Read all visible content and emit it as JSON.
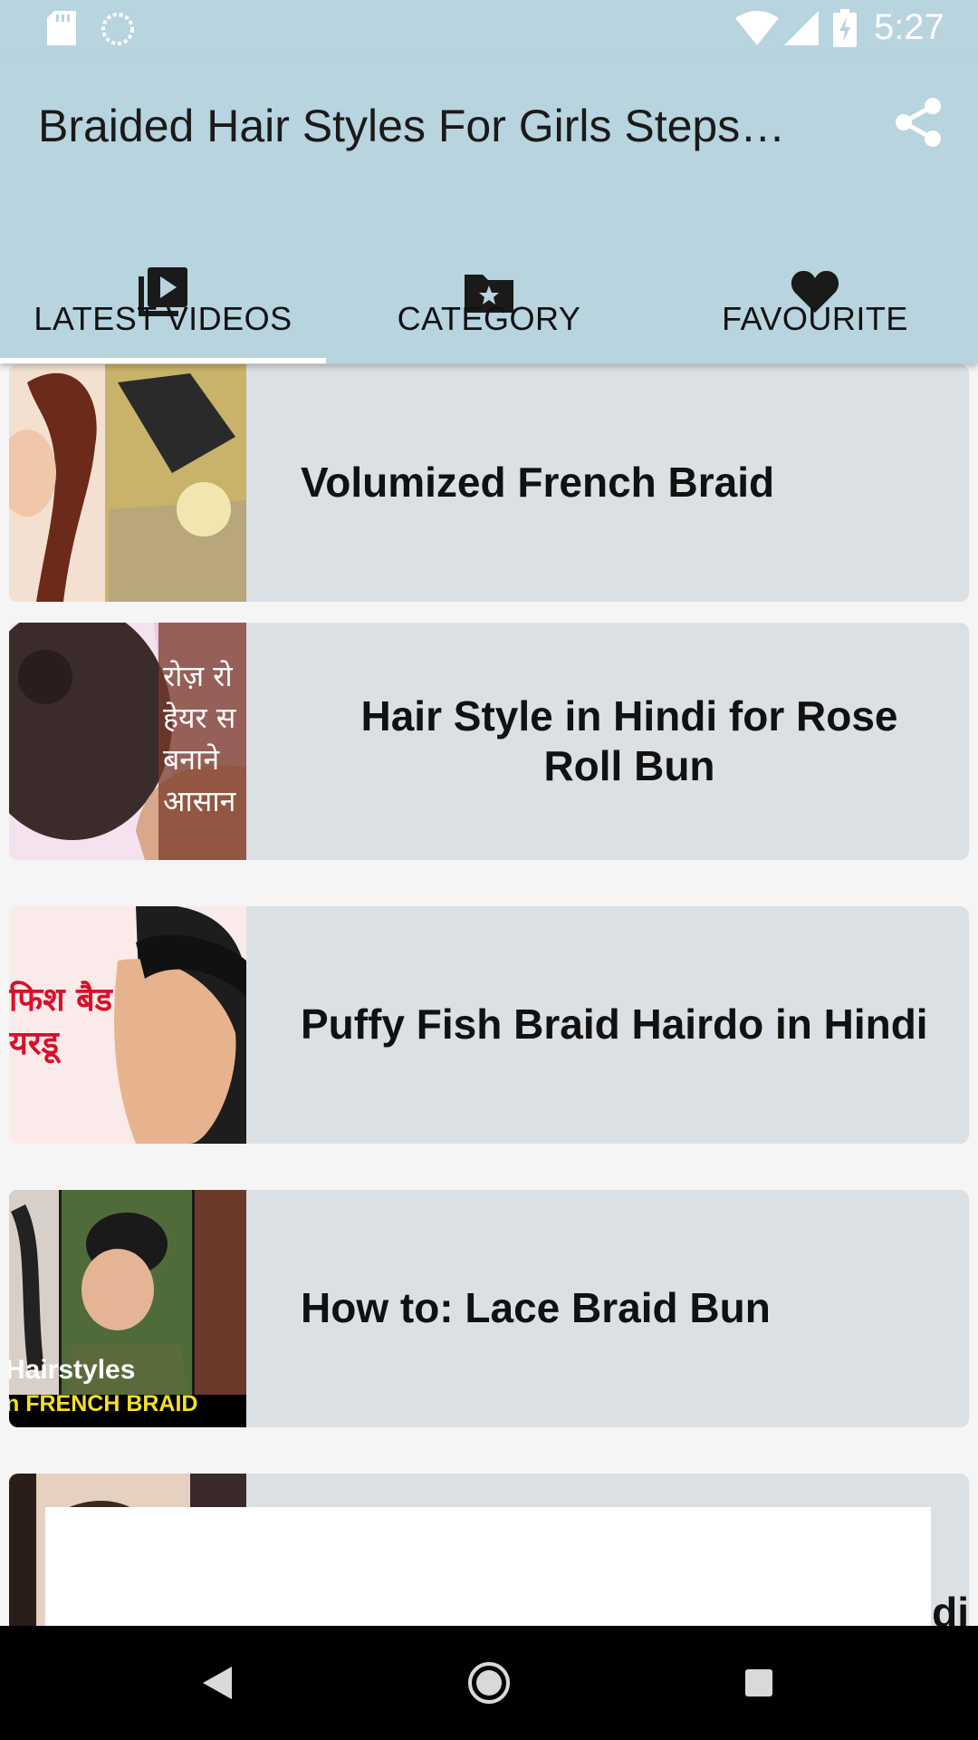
{
  "status_bar": {
    "time": "5:27",
    "icons": [
      "sd-card-icon",
      "sync-icon",
      "wifi-icon",
      "signal-icon",
      "battery-charging-icon"
    ]
  },
  "app_bar": {
    "title": "Braided Hair Styles For Girls Steps…",
    "share_icon": "share-icon",
    "background": "#b8d4de"
  },
  "tabs": [
    {
      "label": "LATEST VIDEOS",
      "icon": "video-library-icon",
      "selected": true
    },
    {
      "label": "CATEGORY",
      "icon": "folder-star-icon",
      "selected": false
    },
    {
      "label": "FAVOURITE",
      "icon": "heart-icon",
      "selected": false
    }
  ],
  "videos": [
    {
      "title": "Volumized French Braid",
      "thumb_text": ""
    },
    {
      "title": "Hair Style in Hindi for Rose Roll Bun",
      "thumb_text": "रोज़ रो हेयर स बनाने आसान"
    },
    {
      "title": "Puffy Fish Braid Hairdo in Hindi",
      "thumb_text": "फिश बैड यरडू"
    },
    {
      "title": "How to: Lace Braid Bun",
      "thumb_text": "Hairstyles",
      "thumb_text2": "n FRENCH BRAID"
    },
    {
      "title": "di",
      "thumb_text": ""
    }
  ],
  "nav": [
    "back-icon",
    "home-icon",
    "recents-icon"
  ]
}
